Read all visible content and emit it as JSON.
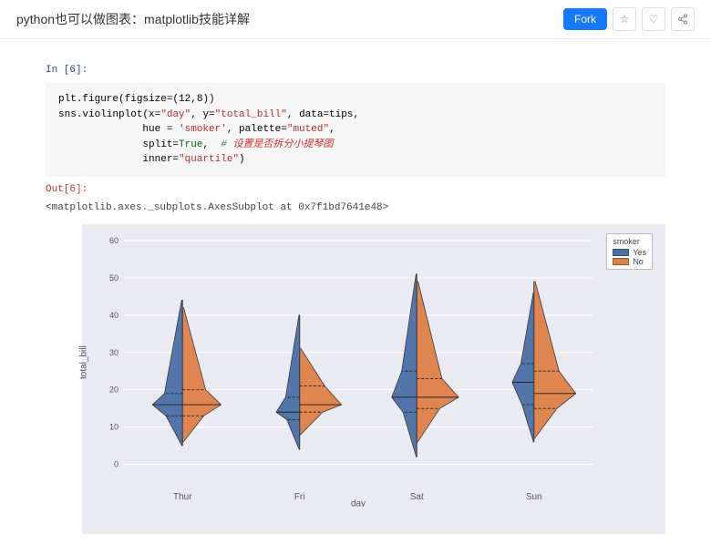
{
  "header": {
    "title": "python也可以做图表：matplotlib技能详解",
    "fork_label": "Fork"
  },
  "cell": {
    "in_label": "In [6]:",
    "out_label": "Out[6]:",
    "code_plain": "plt.figure(figsize=(12,8))\nsns.violinplot(x=\"day\", y=\"total_bill\", data=tips,\n              hue = 'smoker', palette=\"muted\",\n              split=True,  # 设置是否拆分小提琴图\n              inner=\"quartile\")",
    "out_text": "<matplotlib.axes._subplots.AxesSubplot at 0x7f1bd7641e48>"
  },
  "legend": {
    "title": "smoker",
    "items": [
      {
        "label": "Yes",
        "color": "#4a6fa5"
      },
      {
        "label": "No",
        "color": "#dd8047"
      }
    ]
  },
  "axes": {
    "ylabel": "total_bill",
    "xlabel": "day",
    "yticks": [
      0,
      10,
      20,
      30,
      40,
      50,
      60
    ],
    "ymin": -5,
    "ymax": 60,
    "categories": [
      "Thur",
      "Fri",
      "Sat",
      "Sun"
    ]
  },
  "chart_data": {
    "type": "violin-split",
    "xlabel": "day",
    "ylabel": "total_bill",
    "categories": [
      "Thur",
      "Fri",
      "Sat",
      "Sun"
    ],
    "hue": "smoker",
    "hue_levels": [
      "Yes",
      "No"
    ],
    "colors": {
      "Yes": "#4a6fa5",
      "No": "#dd8047"
    },
    "ylim": [
      -5,
      60
    ],
    "yticks": [
      0,
      10,
      20,
      30,
      40,
      50,
      60
    ],
    "inner": "quartile",
    "data": {
      "Thur": {
        "Yes": {
          "q1": 13,
          "median": 16,
          "q3": 19,
          "min": 5,
          "max": 44,
          "peak_width": 36
        },
        "No": {
          "q1": 13,
          "median": 16,
          "q3": 20,
          "min": 6,
          "max": 42,
          "peak_width": 46
        }
      },
      "Fri": {
        "Yes": {
          "q1": 12,
          "median": 14,
          "q3": 18,
          "min": 4,
          "max": 40,
          "peak_width": 28
        },
        "No": {
          "q1": 14,
          "median": 16,
          "q3": 21,
          "min": 8,
          "max": 31,
          "peak_width": 50
        }
      },
      "Sat": {
        "Yes": {
          "q1": 14,
          "median": 18,
          "q3": 25,
          "min": 2,
          "max": 51,
          "peak_width": 30
        },
        "No": {
          "q1": 15,
          "median": 18,
          "q3": 23,
          "min": 6,
          "max": 49,
          "peak_width": 50
        }
      },
      "Sun": {
        "Yes": {
          "q1": 16,
          "median": 22,
          "q3": 27,
          "min": 6,
          "max": 46,
          "peak_width": 26
        },
        "No": {
          "q1": 15,
          "median": 19,
          "q3": 25,
          "min": 7,
          "max": 49,
          "peak_width": 50
        }
      }
    }
  }
}
